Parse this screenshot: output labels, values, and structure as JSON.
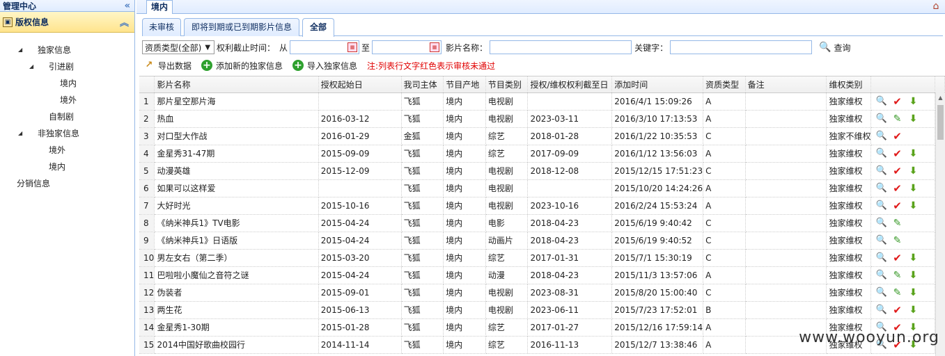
{
  "sidebar": {
    "header": "管理中心",
    "collapse_glyph": "«",
    "panel_title": "版权信息",
    "panel_collapse_glyph": "︽",
    "tree": [
      {
        "label": "独家信息",
        "level": 1,
        "arrow": "◢"
      },
      {
        "label": "引进剧",
        "level": 2,
        "arrow": "◢"
      },
      {
        "label": "境内",
        "level": 3,
        "arrow": ""
      },
      {
        "label": "境外",
        "level": 3,
        "arrow": ""
      },
      {
        "label": "自制剧",
        "level": 2,
        "arrow": ""
      },
      {
        "label": "非独家信息",
        "level": 1,
        "arrow": "◢"
      },
      {
        "label": "境外",
        "level": 2,
        "arrow": ""
      },
      {
        "label": "境内",
        "level": 2,
        "arrow": ""
      },
      {
        "label": "分销信息",
        "level": 0,
        "arrow": ""
      }
    ]
  },
  "top_tab": "境内",
  "sub_tabs": [
    "未审核",
    "即将到期或已到期影片信息",
    "全部"
  ],
  "filters": {
    "qual_type": "资质类型(全部)",
    "deadline_label": "权利截止时间：",
    "from_label": "从",
    "to_label": "至",
    "film_label": "影片名称：",
    "keyword_label": "关键字：",
    "query": "查询"
  },
  "actions": {
    "export": "导出数据",
    "add": "添加新的独家信息",
    "import": "导入独家信息",
    "note": "注:列表行文字红色表示审核未通过"
  },
  "columns": [
    "影片名称",
    "授权起始日",
    "我司主体",
    "节目产地",
    "节目类别",
    "授权/维权权利截至日",
    "添加时间",
    "资质类型",
    "备注",
    "维权类别"
  ],
  "rows": [
    {
      "n": "1",
      "name": "那片星空那片海",
      "start": "",
      "entity": "飞狐",
      "origin": "境内",
      "cat": "电视剧",
      "end": "",
      "added": "2016/4/1 15:09:26",
      "qual": "A",
      "remark": "",
      "type": "独家维权",
      "icons": [
        "view",
        "check",
        "down"
      ]
    },
    {
      "n": "2",
      "name": "热血",
      "start": "2016-03-12",
      "entity": "飞狐",
      "origin": "境内",
      "cat": "电视剧",
      "end": "2023-03-11",
      "added": "2016/3/10 17:13:53",
      "qual": "A",
      "remark": "",
      "type": "独家维权",
      "icons": [
        "view",
        "edit",
        "down"
      ]
    },
    {
      "n": "3",
      "name": "对口型大作战",
      "start": "2016-01-29",
      "entity": "金狐",
      "origin": "境内",
      "cat": "综艺",
      "end": "2018-01-28",
      "added": "2016/1/22 10:35:53",
      "qual": "C",
      "remark": "",
      "type": "独家不维权",
      "icons": [
        "view",
        "check"
      ]
    },
    {
      "n": "4",
      "name": "金星秀31-47期",
      "start": "2015-09-09",
      "entity": "飞狐",
      "origin": "境内",
      "cat": "综艺",
      "end": "2017-09-09",
      "added": "2016/1/12 13:56:03",
      "qual": "A",
      "remark": "",
      "type": "独家维权",
      "icons": [
        "view",
        "check",
        "down"
      ]
    },
    {
      "n": "5",
      "name": "动漫英雄",
      "start": "2015-12-09",
      "entity": "飞狐",
      "origin": "境内",
      "cat": "电视剧",
      "end": "2018-12-08",
      "added": "2015/12/15 17:51:23",
      "qual": "C",
      "remark": "",
      "type": "独家维权",
      "icons": [
        "view",
        "check",
        "down"
      ]
    },
    {
      "n": "6",
      "name": "如果可以这样爱",
      "start": "",
      "entity": "飞狐",
      "origin": "境内",
      "cat": "电视剧",
      "end": "",
      "added": "2015/10/20 14:24:26",
      "qual": "A",
      "remark": "",
      "type": "独家维权",
      "icons": [
        "view",
        "check",
        "down"
      ]
    },
    {
      "n": "7",
      "name": "大好时光",
      "start": "2015-10-16",
      "entity": "飞狐",
      "origin": "境内",
      "cat": "电视剧",
      "end": "2023-10-16",
      "added": "2016/2/24 15:53:24",
      "qual": "A",
      "remark": "",
      "type": "独家维权",
      "icons": [
        "view",
        "check",
        "down"
      ]
    },
    {
      "n": "8",
      "name": "《纳米神兵1》TV电影",
      "start": "2015-04-24",
      "entity": "飞狐",
      "origin": "境内",
      "cat": "电影",
      "end": "2018-04-23",
      "added": "2015/6/19 9:40:42",
      "qual": "C",
      "remark": "",
      "type": "独家维权",
      "icons": [
        "view",
        "edit"
      ]
    },
    {
      "n": "9",
      "name": "《纳米神兵1》日语版",
      "start": "2015-04-24",
      "entity": "飞狐",
      "origin": "境内",
      "cat": "动画片",
      "end": "2018-04-23",
      "added": "2015/6/19 9:40:52",
      "qual": "C",
      "remark": "",
      "type": "独家维权",
      "icons": [
        "view",
        "edit"
      ]
    },
    {
      "n": "10",
      "name": "男左女右（第二季）",
      "start": "2015-03-20",
      "entity": "飞狐",
      "origin": "境内",
      "cat": "综艺",
      "end": "2017-01-31",
      "added": "2015/7/1 15:30:19",
      "qual": "C",
      "remark": "",
      "type": "独家维权",
      "icons": [
        "view",
        "check",
        "down"
      ]
    },
    {
      "n": "11",
      "name": "巴啦啦小魔仙之音符之谜",
      "start": "2015-04-24",
      "entity": "飞狐",
      "origin": "境内",
      "cat": "动漫",
      "end": "2018-04-23",
      "added": "2015/11/3 13:57:06",
      "qual": "A",
      "remark": "",
      "type": "独家维权",
      "icons": [
        "view",
        "edit",
        "down"
      ]
    },
    {
      "n": "12",
      "name": "伪装者",
      "start": "2015-09-01",
      "entity": "飞狐",
      "origin": "境内",
      "cat": "电视剧",
      "end": "2023-08-31",
      "added": "2015/8/20 15:00:40",
      "qual": "C",
      "remark": "",
      "type": "独家维权",
      "icons": [
        "view",
        "edit",
        "down"
      ]
    },
    {
      "n": "13",
      "name": "两生花",
      "start": "2015-06-13",
      "entity": "飞狐",
      "origin": "境内",
      "cat": "电视剧",
      "end": "2023-06-11",
      "added": "2015/7/23 17:52:01",
      "qual": "B",
      "remark": "",
      "type": "独家维权",
      "icons": [
        "view",
        "check",
        "down"
      ]
    },
    {
      "n": "14",
      "name": "金星秀1-30期",
      "start": "2015-01-28",
      "entity": "飞狐",
      "origin": "境内",
      "cat": "综艺",
      "end": "2017-01-27",
      "added": "2015/12/16 17:59:14",
      "qual": "A",
      "remark": "",
      "type": "独家维权",
      "icons": [
        "view",
        "check",
        "down"
      ]
    },
    {
      "n": "15",
      "name": "2014中国好歌曲校园行",
      "start": "2014-11-14",
      "entity": "飞狐",
      "origin": "境内",
      "cat": "综艺",
      "end": "2016-11-13",
      "added": "2015/12/7 13:38:46",
      "qual": "A",
      "remark": "",
      "type": "独家维权",
      "icons": [
        "view",
        "check",
        "down"
      ]
    }
  ],
  "icon_glyphs": {
    "view": "🔍",
    "check": "✔",
    "edit": "✎",
    "down": "⬇"
  },
  "watermark": "www.wooyun.org",
  "colors": {
    "accent_border": "#95b8e7",
    "panel_yellow": "#ffe48d",
    "error_red": "#e00000"
  }
}
